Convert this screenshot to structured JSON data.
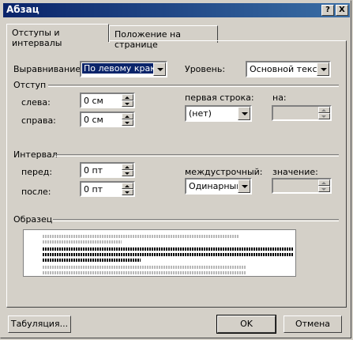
{
  "window": {
    "title": "Абзац",
    "help_button": "?",
    "close_button": "X"
  },
  "tabs": [
    {
      "label": "Отступы и интервалы",
      "active": true
    },
    {
      "label": "Положение на странице",
      "active": false
    }
  ],
  "alignment": {
    "label": "Выравнивание:",
    "value": "По левому краю"
  },
  "level": {
    "label": "Уровень:",
    "value": "Основной текст"
  },
  "indent": {
    "group_label": "Отступ",
    "left": {
      "label": "слева:",
      "value": "0 см"
    },
    "right": {
      "label": "справа:",
      "value": "0 см"
    },
    "first_line": {
      "label": "первая строка:",
      "value": "(нет)"
    },
    "by": {
      "label": "на:",
      "value": ""
    }
  },
  "spacing": {
    "group_label": "Интервал",
    "before": {
      "label": "перед:",
      "value": "0 пт"
    },
    "after": {
      "label": "после:",
      "value": "0 пт"
    },
    "line_spacing": {
      "label": "междустрочный:",
      "value": "Одинарный"
    },
    "at": {
      "label": "значение:",
      "value": ""
    }
  },
  "preview": {
    "group_label": "Образец"
  },
  "buttons": {
    "tabs": "Табуляция...",
    "ok": "OK",
    "cancel": "Отмена"
  },
  "colors": {
    "titlebar": "#0a246a",
    "selection": "#0a246a",
    "face": "#d4d0c8"
  }
}
